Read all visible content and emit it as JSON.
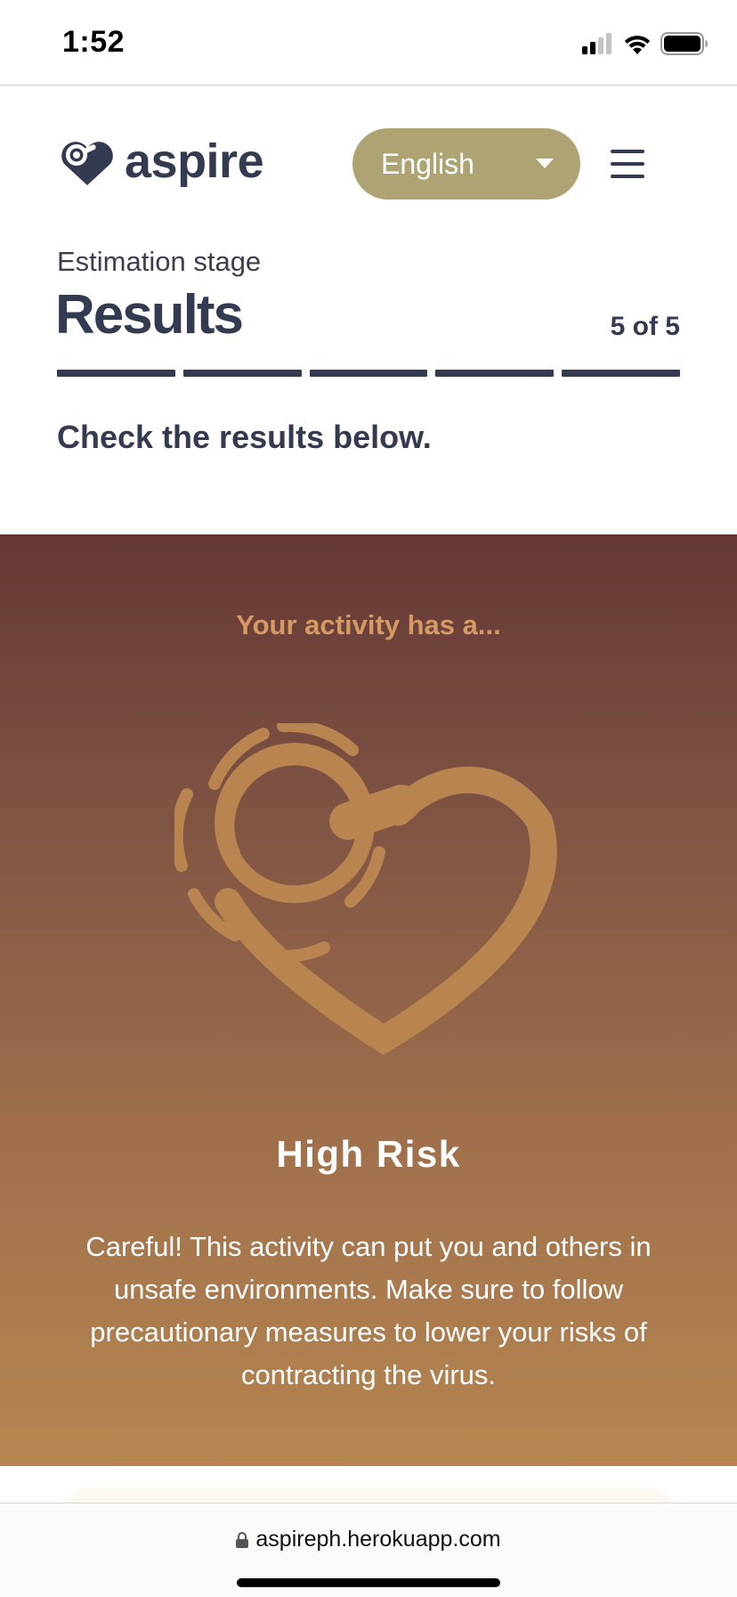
{
  "status_bar": {
    "time": "1:52"
  },
  "header": {
    "brand": "aspire",
    "language": {
      "selected": "English"
    }
  },
  "stage": {
    "label": "Estimation stage",
    "title": "Results",
    "step": "5 of 5",
    "total_steps": 5,
    "completed_steps": 5
  },
  "instruction": "Check the results below.",
  "result": {
    "intro": "Your activity has a...",
    "risk_level": "High Risk",
    "description": "Careful! This activity can put you and others in unsafe environments. Make sure to follow precautionary measures to lower your risks of contracting the virus."
  },
  "browser": {
    "url": "aspireph.herokuapp.com"
  },
  "colors": {
    "navy": "#343a4f",
    "language_button": "#ada373",
    "panel_top": "#633834",
    "panel_bottom": "#b58650",
    "accent_text": "#d49a63",
    "icon": "#b8844f"
  }
}
